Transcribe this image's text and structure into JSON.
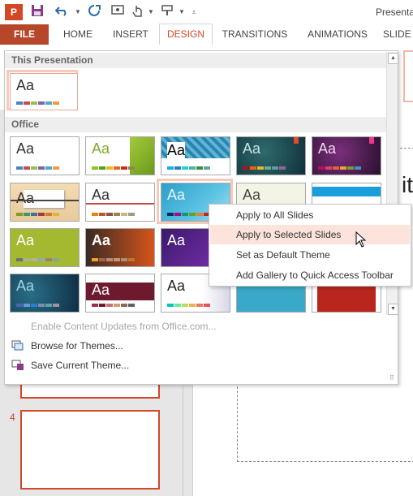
{
  "app": {
    "icon_label": "P",
    "window_title": "Presentat"
  },
  "qat": {
    "icons": [
      "save-icon",
      "undo-icon",
      "undo-dropdown-icon",
      "redo-icon",
      "start-slideshow-icon",
      "touch-mode-icon",
      "format-painter-icon",
      "customize-qat-icon"
    ]
  },
  "tabs": [
    {
      "label": "FILE"
    },
    {
      "label": "HOME"
    },
    {
      "label": "INSERT"
    },
    {
      "label": "DESIGN"
    },
    {
      "label": "TRANSITIONS"
    },
    {
      "label": "ANIMATIONS"
    },
    {
      "label": "SLIDE"
    }
  ],
  "gallery": {
    "section_this": "This Presentation",
    "section_office": "Office",
    "aa_label": "Aa",
    "commands": [
      {
        "label": "Enable Content Updates from Office.com...",
        "enabled": false
      },
      {
        "label": "Browse for Themes...",
        "enabled": true
      },
      {
        "label": "Save Current Theme...",
        "enabled": true
      }
    ],
    "themes_rows": 4,
    "themes_cols": 5
  },
  "context_menu": {
    "items": [
      {
        "label": "Apply to All Slides"
      },
      {
        "label": "Apply to Selected Slides"
      },
      {
        "label": "Set as Default Theme"
      },
      {
        "label": "Add Gallery to Quick Access Toolbar"
      }
    ],
    "hovered_index": 1
  },
  "slides": {
    "visible_number": "4"
  },
  "slide_title_partial": "it",
  "colors": {
    "accent": "#d24726",
    "file_tab": "#b7472a",
    "hover_bg": "#fce4dc",
    "selected_border": "#f8c8b8"
  }
}
